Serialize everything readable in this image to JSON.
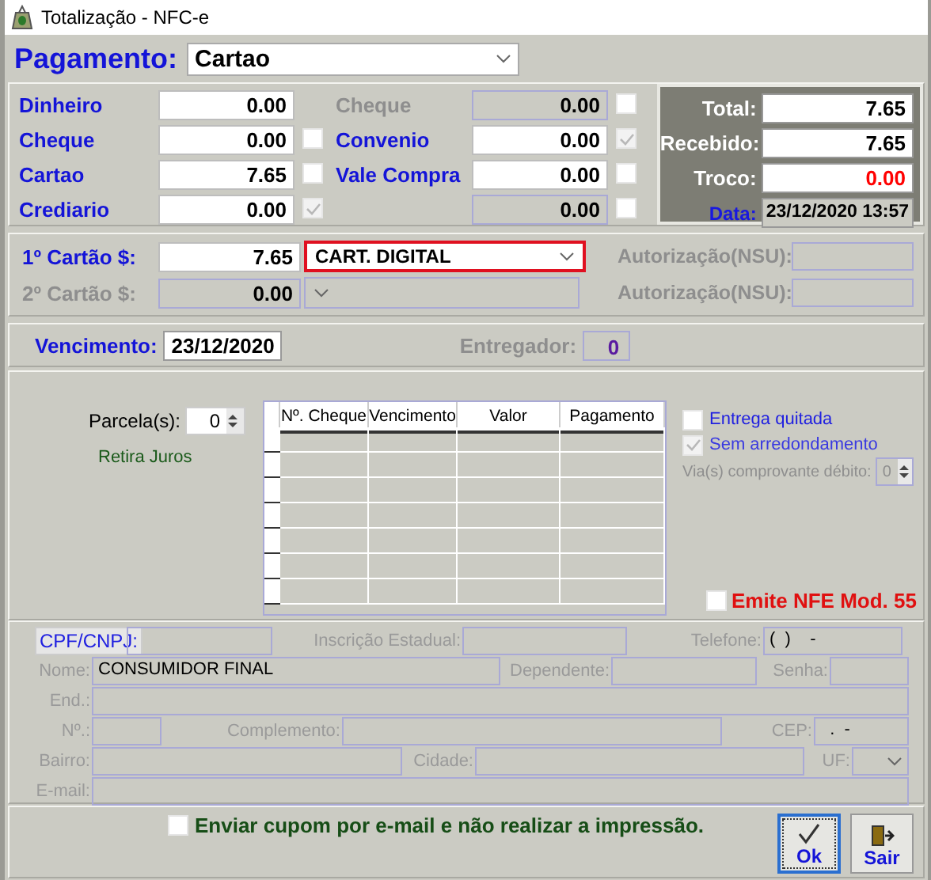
{
  "window": {
    "title": "Totalização - NFC-e"
  },
  "payment": {
    "label": "Pagamento:",
    "value": "Cartao"
  },
  "amounts": [
    {
      "label": "Dinheiro",
      "value": "0.00",
      "disabled": false
    },
    {
      "label": "Cheque",
      "value": "0.00",
      "disabled": true,
      "checked": false
    },
    {
      "label": "Cheque",
      "value": "0.00",
      "disabled": false,
      "checked": false
    },
    {
      "label": "Convenio",
      "value": "0.00",
      "disabled": false,
      "checked": true
    },
    {
      "label": "Cartao",
      "value": "7.65",
      "disabled": false,
      "checked": false
    },
    {
      "label": "Vale Compra",
      "value": "0.00",
      "disabled": false,
      "checked": false
    },
    {
      "label": "Crediario",
      "value": "0.00",
      "disabled": false,
      "checked": true
    },
    {
      "value": "0.00",
      "disabled": true,
      "checked": false
    }
  ],
  "totals": [
    {
      "label": "Total:",
      "value": "7.65",
      "kind": "total"
    },
    {
      "label": "Recebido:",
      "value": "7.65",
      "kind": "total"
    },
    {
      "label": "Troco:",
      "value": "0.00",
      "kind": "total",
      "color": "#ff0000"
    },
    {
      "label": "Data:",
      "value": "23/12/2020 13:57",
      "kind": "date"
    }
  ],
  "cards": [
    {
      "label": "1º Cartão $:",
      "amount": "7.65",
      "brand": "CART. DIGITAL",
      "auth_label": "Autorização(NSU):",
      "disabled": false,
      "focused": true
    },
    {
      "label": "2º Cartão $:",
      "amount": "0.00",
      "auth_label": "Autorização(NSU):",
      "disabled": true,
      "focused": false
    }
  ],
  "due": {
    "label": "Vencimento:",
    "value": "23/12/2020"
  },
  "courier": {
    "label": "Entregador:",
    "value": "0"
  },
  "installments": {
    "label": "Parcela(s):",
    "value": "0",
    "link": "Retira Juros"
  },
  "table": {
    "columns": [
      "Nº. Cheque",
      "Vencimento",
      "Valor",
      "Pagamento"
    ]
  },
  "options": [
    {
      "label": "Entrega quitada",
      "checked": false,
      "disabled": false
    },
    {
      "label": "Sem arredondamento",
      "checked": true,
      "disabled": true
    }
  ],
  "debit_copies": {
    "label": "Via(s) comprovante débito:",
    "value": "0"
  },
  "emit_nfe": {
    "label": "Emite NFE Mod. 55",
    "checked": false
  },
  "customer": [
    [
      {
        "label": "CPF/CNPJ:",
        "kind": "button"
      },
      {
        "label": "Inscrição Estadual:"
      },
      {
        "label": "Telefone:",
        "value": "(  )    -"
      }
    ],
    [
      {
        "label": "Nome:",
        "value": "CONSUMIDOR FINAL"
      },
      {
        "label": "Dependente:"
      },
      {
        "label": "Senha:"
      }
    ],
    [
      {
        "label": "End.:"
      }
    ],
    [
      {
        "label": "Nº.:"
      },
      {
        "label": "Complemento:"
      },
      {
        "label": "CEP:",
        "value": "  .  -"
      }
    ],
    [
      {
        "label": "Bairro:"
      },
      {
        "label": "Cidade:"
      },
      {
        "label": "UF:",
        "kind": "select"
      }
    ],
    [
      {
        "label": "E-mail:"
      }
    ]
  ],
  "email_option": {
    "label": "Enviar cupom por e-mail e não realizar a impressão.",
    "checked": false
  },
  "buttons": [
    {
      "label": "Ok",
      "kind": "ok",
      "focused": true
    },
    {
      "label": "Sair",
      "kind": "exit",
      "focused": false
    }
  ]
}
